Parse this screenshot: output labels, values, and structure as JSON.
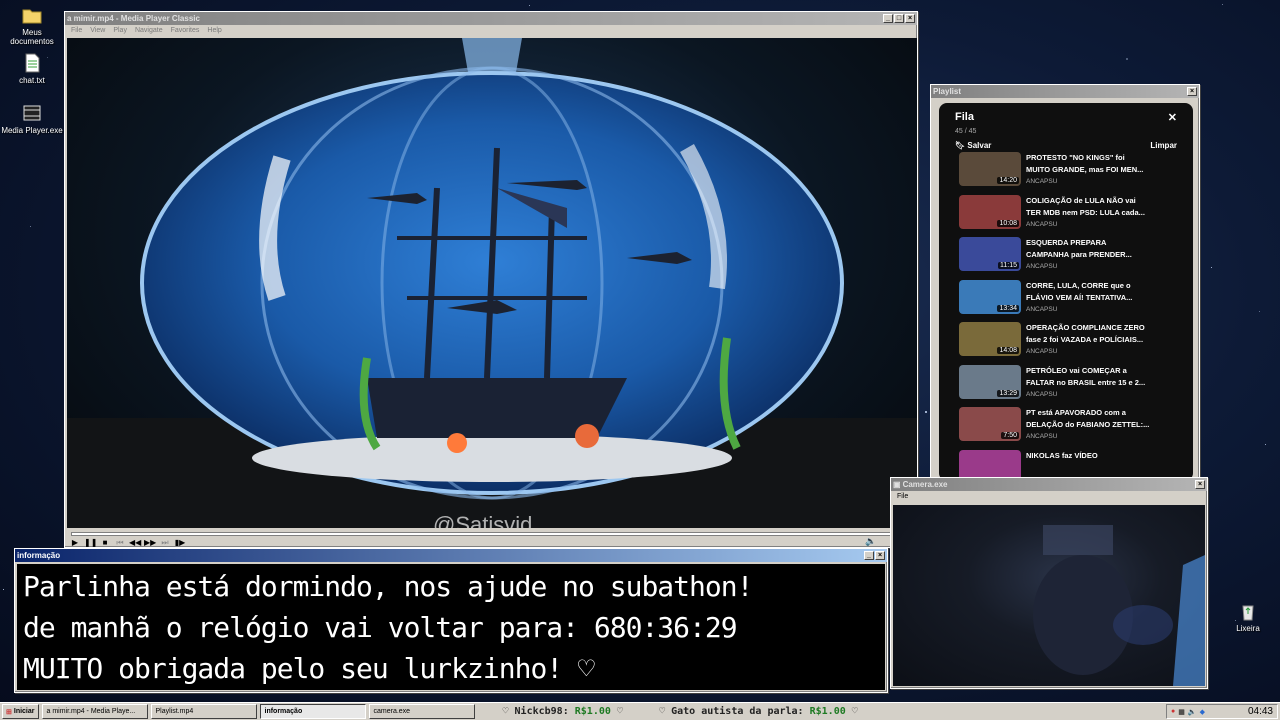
{
  "desktop": {
    "icons": [
      {
        "label": "Meus documentos",
        "icon": "folder-icon"
      },
      {
        "label": "chat.txt",
        "icon": "text-file-icon"
      },
      {
        "label": "Media Player.exe",
        "icon": "media-player-icon"
      },
      {
        "label": "Lixeira",
        "icon": "recycle-bin-icon"
      }
    ]
  },
  "media_player": {
    "title": "a mimir.mp4 - Media Player Classic",
    "menu": [
      "File",
      "View",
      "Play",
      "Navigate",
      "Favorites",
      "Help"
    ],
    "watermark": "@Satisvid",
    "seek_progress": 0.0,
    "controls": [
      "play-icon",
      "pause-icon",
      "stop-icon",
      "previous-icon",
      "rewind-icon",
      "forward-icon",
      "next-icon",
      "frame-step-icon"
    ]
  },
  "playlist": {
    "window_title": "Playlist",
    "header": "Fila",
    "count": "45 / 45",
    "save_label": "Salvar",
    "clear_label": "Limpar",
    "items": [
      {
        "title1": "PROTESTO \"NO KINGS\" foi",
        "title2": "MUITO GRANDE, mas FOI MEN...",
        "channel": "ANCAPSU",
        "duration": "14:20",
        "thumb": "#5a4a3a"
      },
      {
        "title1": "COLIGAÇÃO de LULA NÃO vai",
        "title2": "TER MDB nem PSD: LULA cada...",
        "channel": "ANCAPSU",
        "duration": "10:08",
        "thumb": "#8a3a3a"
      },
      {
        "title1": "ESQUERDA PREPARA",
        "title2": "CAMPANHA para PRENDER...",
        "channel": "ANCAPSU",
        "duration": "11:15",
        "thumb": "#3a4a9a"
      },
      {
        "title1": "CORRE, LULA, CORRE que o",
        "title2": "FLÁVIO VEM AÍ! TENTATIVA...",
        "channel": "ANCAPSU",
        "duration": "13:34",
        "thumb": "#3a7ab8"
      },
      {
        "title1": "OPERAÇÃO COMPLIANCE ZERO",
        "title2": "fase 2 foi VAZADA e POLÍCIAIS...",
        "channel": "ANCAPSU",
        "duration": "14:08",
        "thumb": "#7a6a3a"
      },
      {
        "title1": "PETRÓLEO vai COMEÇAR a",
        "title2": "FALTAR no BRASIL entre 15 e 2...",
        "channel": "ANCAPSU",
        "duration": "13:29",
        "thumb": "#6a7a8a"
      },
      {
        "title1": "PT está APAVORADO com a",
        "title2": "DELAÇÃO do FABIANO ZETTEL:...",
        "channel": "ANCAPSU",
        "duration": "7:50",
        "thumb": "#8a4a4a"
      },
      {
        "title1": "NIKOLAS faz VÍDEO",
        "title2": "",
        "channel": "",
        "duration": "",
        "thumb": "#9a3a8a"
      }
    ]
  },
  "info_window": {
    "title": "informação",
    "lines": [
      "Parlinha está dormindo, nos ajude no subathon!",
      "de manhã o relógio vai voltar para:  680:36:29",
      "MUITO obrigada pelo seu lurkzinho! ♡"
    ]
  },
  "camera": {
    "title": "Camera.exe",
    "menu": [
      "File"
    ]
  },
  "taskbar": {
    "start_label": "Iniciar",
    "tasks": [
      {
        "label": "a mimir.mp4 - Media Playe...",
        "pressed": false
      },
      {
        "label": "Playlist.mp4",
        "pressed": false
      },
      {
        "label": "informação",
        "pressed": true
      },
      {
        "label": "camera.exe",
        "pressed": false
      }
    ],
    "ticker": [
      {
        "name": "♡ Nickcb98:",
        "amount": "R$1.00",
        "suffix": "♡"
      },
      {
        "name": "♡ Gato autista da parla:",
        "amount": "R$1.00",
        "suffix": "♡"
      }
    ],
    "clock": "04:43",
    "colors": {
      "amount": "#1e7a23"
    }
  }
}
